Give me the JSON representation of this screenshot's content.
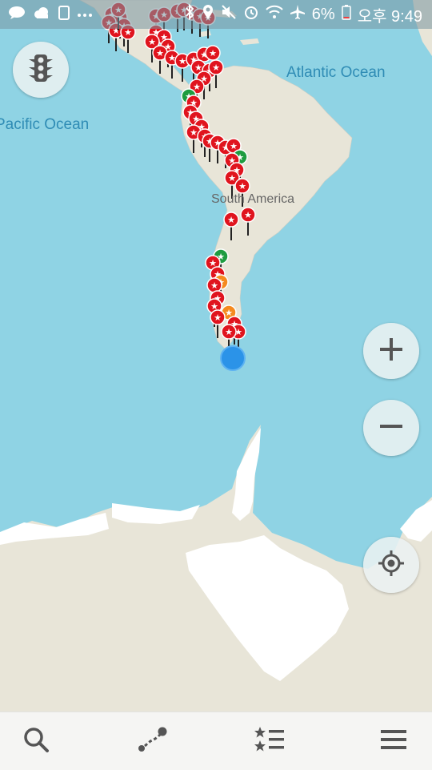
{
  "map": {
    "labels": {
      "atlantic": "Atlantic Ocean",
      "pacific": "Pacific Ocean",
      "south_america": "South America"
    },
    "colors": {
      "water": "#8fd3e4",
      "land": "#e8e5d8",
      "ice": "#ffffff",
      "marker_red": "#e0141e",
      "marker_green": "#1e9c40",
      "marker_orange": "#f58a1f",
      "location_blue": "#2b93e8"
    }
  },
  "status_bar": {
    "battery": "6%",
    "time": "오후 9:49",
    "left_icons": [
      "talk-icon",
      "cloud-icon",
      "nfc-icon",
      "more-icon"
    ],
    "right_icons": [
      "bluetooth-icon",
      "location-icon",
      "mute-icon",
      "alarm-icon",
      "wifi-icon",
      "airplane-icon",
      "battery-icon"
    ]
  },
  "buttons": {
    "traffic": "traffic-light-icon",
    "zoom_in": "plus-icon",
    "zoom_out": "minus-icon",
    "my_location": "crosshair-icon"
  },
  "bottom_nav": [
    "search-icon",
    "route-icon",
    "bookmarks-icon",
    "menu-icon"
  ]
}
